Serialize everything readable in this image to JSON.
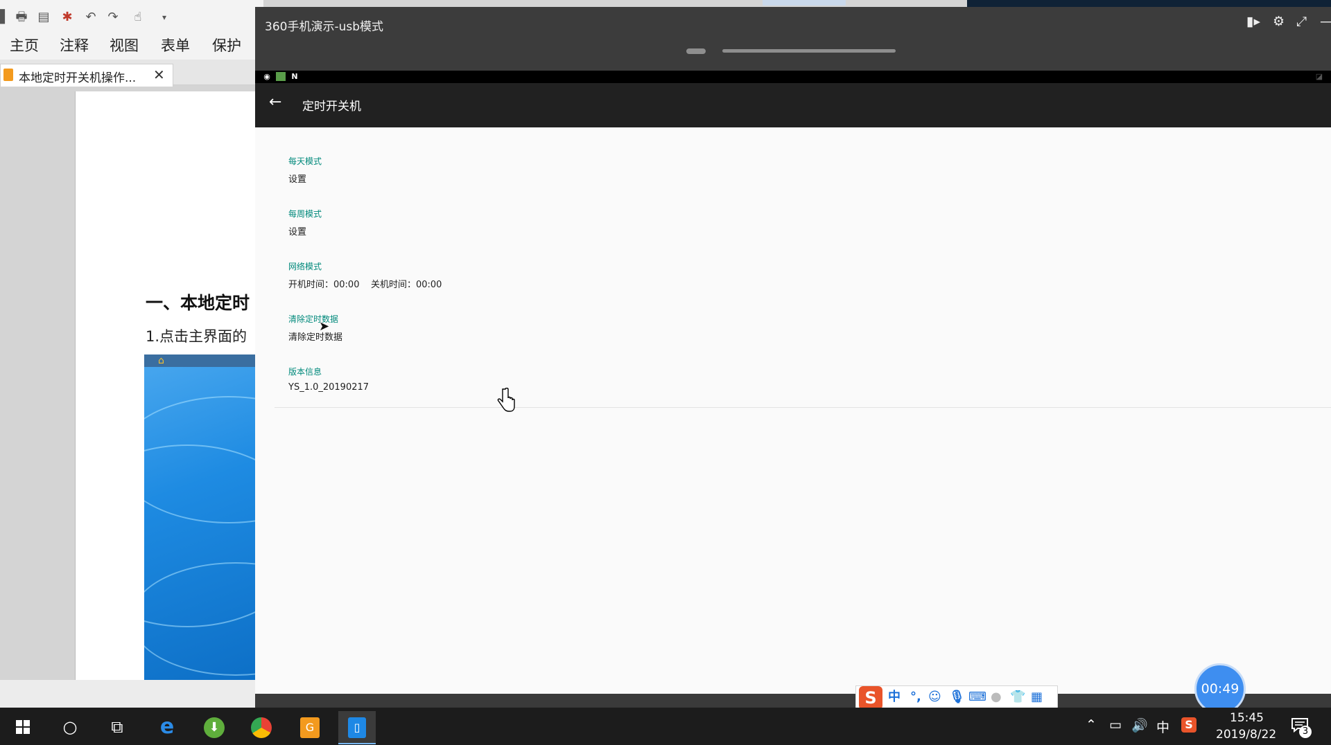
{
  "pdf_reader": {
    "menu": [
      "主页",
      "注释",
      "视图",
      "表单",
      "保护"
    ],
    "tab_label": "本地定时开关机操作...",
    "tab_close": "✕",
    "heading": "一、本地定时",
    "paragraph": "1.点击主界面的"
  },
  "mirror": {
    "title": "360手机演示-usb模式",
    "app_title": "定时开关机",
    "back_glyph": "←",
    "sections": [
      {
        "title": "每天模式",
        "value": "设置"
      },
      {
        "title": "每周模式",
        "value": "设置"
      },
      {
        "title": "网络模式",
        "value": "开机时间：00:00    关机时间：00:00"
      },
      {
        "title": "清除定时数据",
        "value": "清除定时数据"
      },
      {
        "title": "版本信息",
        "value": "YS_1.0_20190217"
      }
    ]
  },
  "ime": {
    "lang": "中",
    "punct": "°,"
  },
  "recording_timer": "00:49",
  "taskbar": {
    "tray_lang": "中",
    "time": "15:45",
    "date": "2019/8/22",
    "notification_count": "3"
  },
  "colors": {
    "section_title": "#00897b",
    "app_bar": "#212121",
    "timer": "#3e8ef0",
    "ime_logo": "#e9542a"
  }
}
